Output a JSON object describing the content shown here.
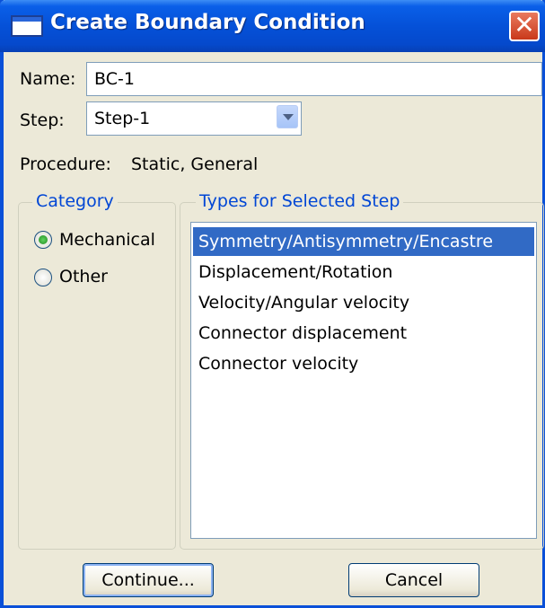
{
  "window": {
    "title": "Create Boundary Condition",
    "close_label": "✕"
  },
  "name": {
    "label": "Name:",
    "value": "BC-1"
  },
  "step": {
    "label": "Step:",
    "value": "Step-1"
  },
  "procedure": {
    "label": "Procedure:",
    "value": "Static, General"
  },
  "category": {
    "legend": "Category",
    "options": [
      {
        "label": "Mechanical",
        "checked": true
      },
      {
        "label": "Other",
        "checked": false
      }
    ]
  },
  "types": {
    "legend": "Types for Selected Step",
    "items": [
      "Symmetry/Antisymmetry/Encastre",
      "Displacement/Rotation",
      "Velocity/Angular velocity",
      "Connector displacement",
      "Connector velocity"
    ],
    "selected_index": 0
  },
  "buttons": {
    "continue": "Continue...",
    "cancel": "Cancel"
  },
  "colors": {
    "titlebar": "#0551d8",
    "selection": "#316ac5",
    "legend": "#0046d5",
    "dialog_bg": "#ece9d8"
  },
  "icons": {
    "window": "window-icon",
    "close": "close-icon",
    "dropdown": "chevron-down-icon"
  }
}
